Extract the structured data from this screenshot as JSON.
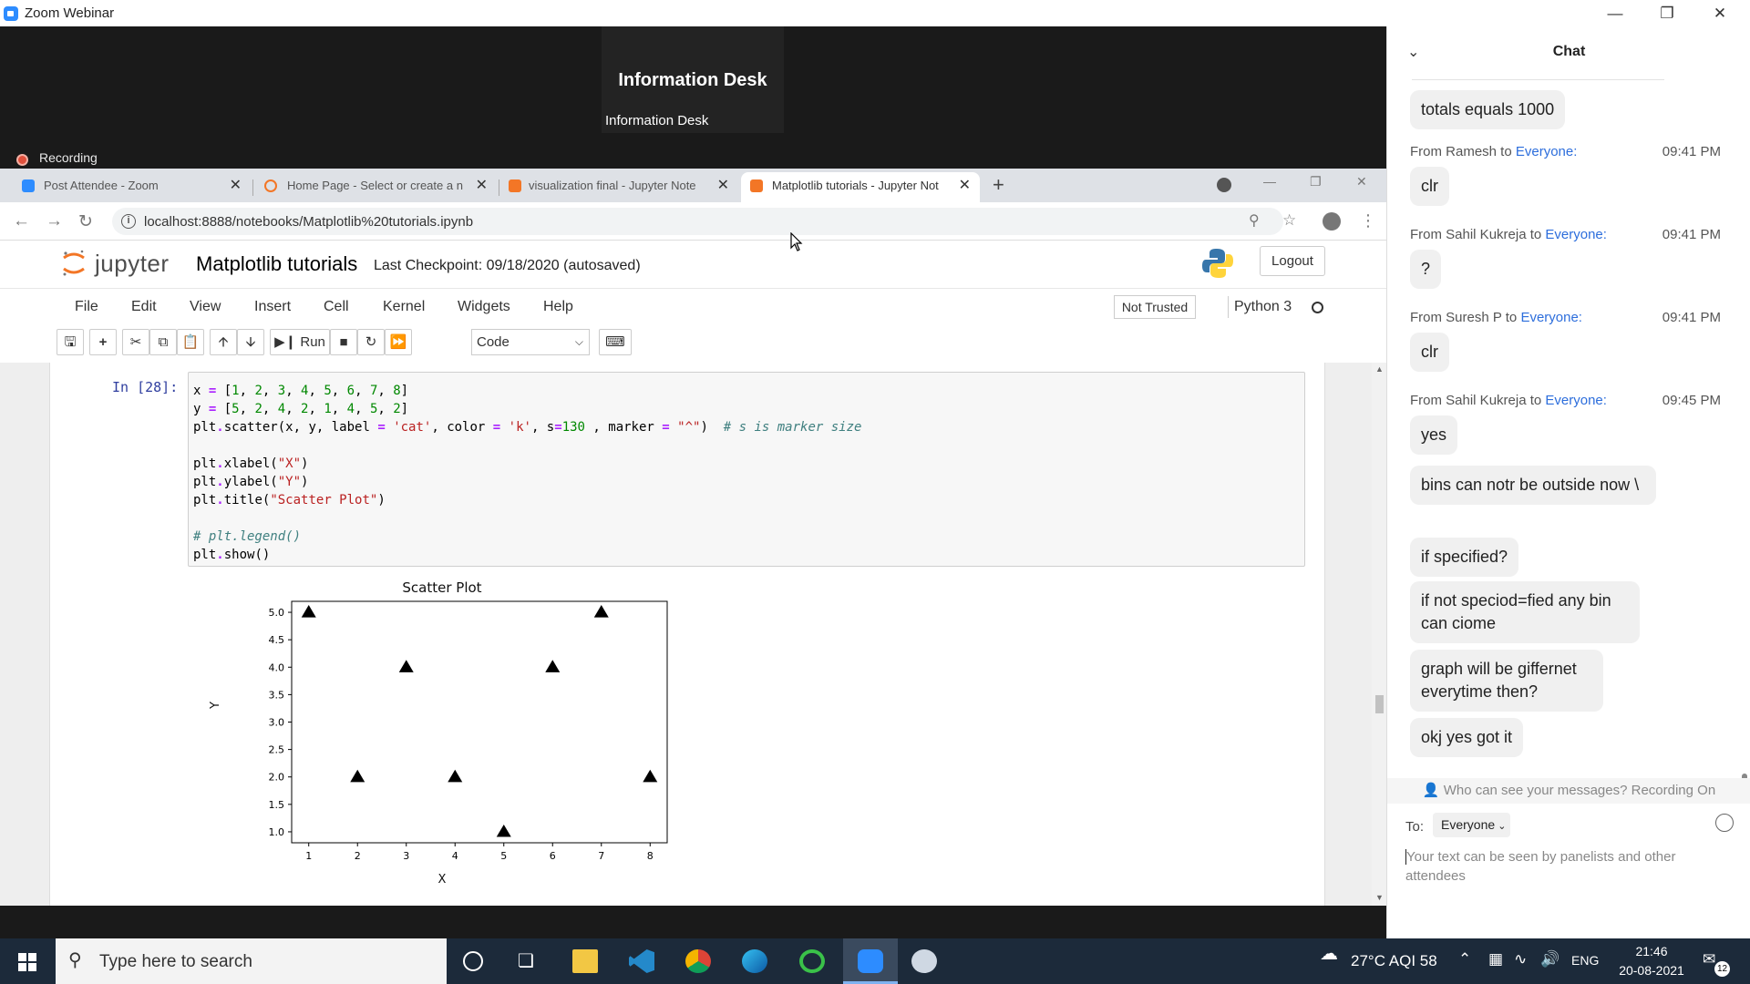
{
  "zoom": {
    "window_title": "Zoom Webinar",
    "speaker_name": "Information Desk",
    "speaker_label": "Information Desk",
    "recording_label": "Recording"
  },
  "browser": {
    "tabs": [
      {
        "label": "Post Attendee - Zoom",
        "color": "#2d8cff"
      },
      {
        "label": "Home Page - Select or create a n",
        "color": "#f37626"
      },
      {
        "label": "visualization final - Jupyter Note",
        "color": "#f37626"
      },
      {
        "label": "Matplotlib tutorials - Jupyter Not",
        "color": "#f37626"
      }
    ],
    "url": "localhost:8888/notebooks/Matplotlib%20tutorials.ipynb"
  },
  "jupyter": {
    "logo_word": "jupyter",
    "notebook_name": "Matplotlib tutorials",
    "checkpoint": "Last Checkpoint: 09/18/2020  (autosaved)",
    "logout": "Logout",
    "menu": [
      "File",
      "Edit",
      "View",
      "Insert",
      "Cell",
      "Kernel",
      "Widgets",
      "Help"
    ],
    "not_trusted": "Not Trusted",
    "kernel": "Python 3",
    "run_label": "Run",
    "cell_type": "Code",
    "prompt": "In [28]:"
  },
  "chart_data": {
    "type": "scatter",
    "title": "Scatter Plot",
    "xlabel": "X",
    "ylabel": "Y",
    "marker": "triangle-up",
    "color": "#000000",
    "x": [
      1,
      2,
      3,
      4,
      5,
      6,
      7,
      8
    ],
    "y": [
      5,
      2,
      4,
      2,
      1,
      4,
      5,
      2
    ],
    "xticks": [
      "1",
      "2",
      "3",
      "4",
      "5",
      "6",
      "7",
      "8"
    ],
    "yticks": [
      "1.0",
      "1.5",
      "2.0",
      "2.5",
      "3.0",
      "3.5",
      "4.0",
      "4.5",
      "5.0"
    ],
    "xlim": [
      0.65,
      8.35
    ],
    "ylim": [
      0.8,
      5.2
    ],
    "grid": false
  },
  "chat": {
    "title": "Chat",
    "first_message": "totals equals 1000",
    "messages": [
      {
        "from": "From Ramesh to ",
        "to": "Everyone:",
        "time": "09:41 PM",
        "text": "clr"
      },
      {
        "from": "From Sahil Kukreja to ",
        "to": "Everyone:",
        "time": "09:41 PM",
        "text": "?"
      },
      {
        "from": "From Suresh P to ",
        "to": "Everyone:",
        "time": "09:41 PM",
        "text": "clr"
      },
      {
        "from": "From Sahil Kukreja to ",
        "to": "Everyone:",
        "time": "09:45 PM",
        "text": "yes"
      }
    ],
    "followups": [
      "bins can notr be outside now \\",
      "if specified?",
      "if not speciod=fied any bin can ciome",
      "graph will be giffernet everytime then?",
      "okj yes got it"
    ],
    "privacy": "Who can see your messages? Recording On",
    "to_label": "To:",
    "to_value": "Everyone",
    "input_placeholder": "Your text can be seen by panelists and other attendees"
  },
  "taskbar": {
    "search_placeholder": "Type here to search",
    "weather": "27°C  AQI 58",
    "language": "ENG",
    "time": "21:46",
    "date": "20-08-2021",
    "notifications": "12"
  }
}
